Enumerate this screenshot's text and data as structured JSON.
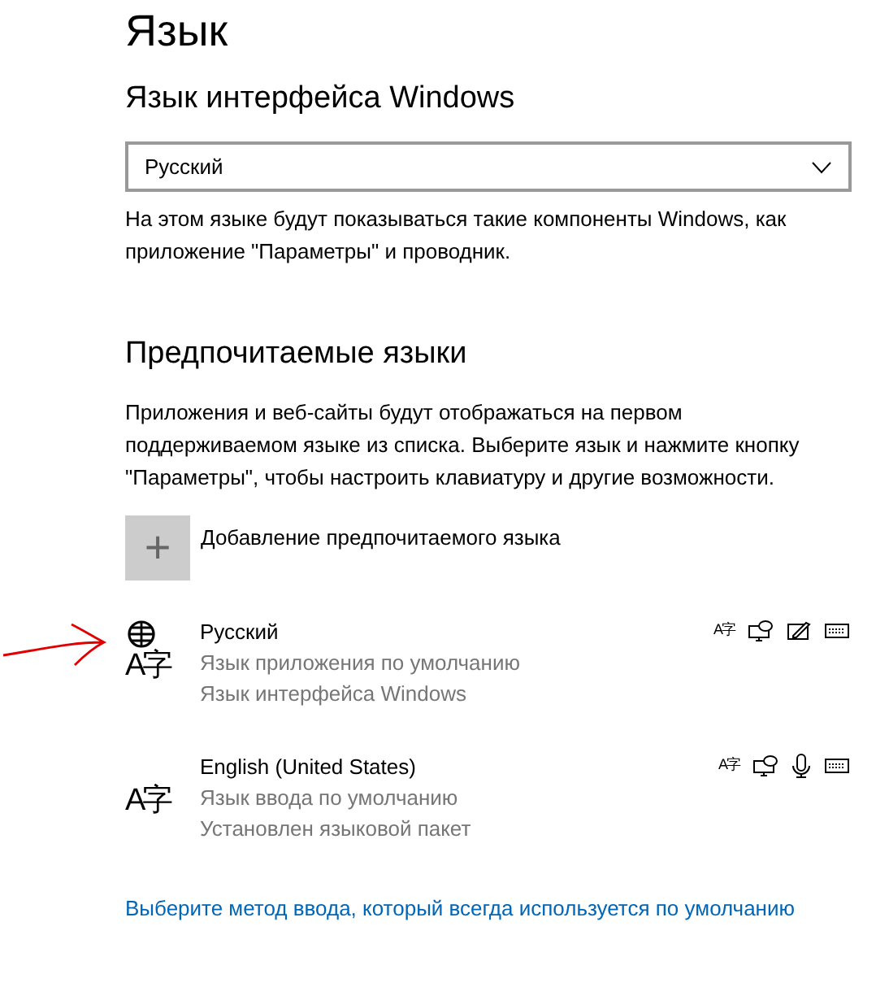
{
  "page_title": "Язык",
  "interface_section": {
    "heading": "Язык интерфейса Windows",
    "dropdown_value": "Русский",
    "description": "На этом языке будут показываться такие компоненты Windows, как приложение \"Параметры\" и проводник."
  },
  "preferred_section": {
    "heading": "Предпочитаемые языки",
    "description": "Приложения и веб-сайты будут отображаться на первом поддерживаемом языке из списка. Выберите язык и нажмите кнопку \"Параметры\", чтобы настроить клавиатуру и другие возможности.",
    "add_button": {
      "icon_glyph": "+",
      "label": "Добавление предпочитаемого языка"
    },
    "languages": [
      {
        "name": "Русский",
        "icon_glyph": "A字",
        "display_language": true,
        "details": [
          "Язык приложения по умолчанию",
          "Язык интерфейса Windows"
        ],
        "annotated": true,
        "features": [
          {
            "kind": "language-pack",
            "glyph": "A字"
          },
          {
            "kind": "speech"
          },
          {
            "kind": "handwriting"
          },
          {
            "kind": "keyboard"
          }
        ]
      },
      {
        "name": "English (United States)",
        "icon_glyph": "A字",
        "display_language": false,
        "details": [
          "Язык ввода по умолчанию",
          "Установлен языковой пакет"
        ],
        "annotated": false,
        "features": [
          {
            "kind": "language-pack",
            "glyph": "A字"
          },
          {
            "kind": "speech"
          },
          {
            "kind": "microphone"
          },
          {
            "kind": "keyboard"
          }
        ]
      }
    ]
  },
  "link": "Выберите метод ввода, который всегда используется по умолчанию"
}
